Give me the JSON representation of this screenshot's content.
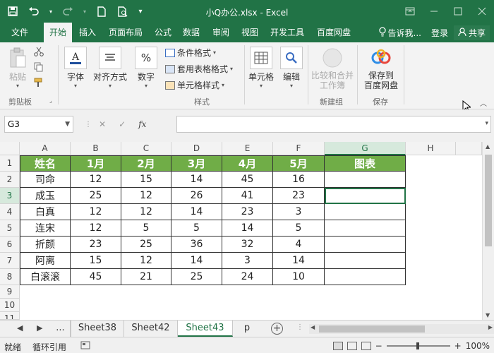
{
  "window": {
    "title": "小Q办公.xlsx - Excel"
  },
  "tabs": [
    {
      "label": "文件"
    },
    {
      "label": "开始"
    },
    {
      "label": "插入"
    },
    {
      "label": "页面布局"
    },
    {
      "label": "公式"
    },
    {
      "label": "数据"
    },
    {
      "label": "审阅"
    },
    {
      "label": "视图"
    },
    {
      "label": "开发工具"
    },
    {
      "label": "百度网盘"
    }
  ],
  "tellme": "告诉我...",
  "login": "登录",
  "share": "共享",
  "ribbon": {
    "paste": "粘贴",
    "clipboard": "剪贴板",
    "font": "字体",
    "align": "对齐方式",
    "number": "数字",
    "percent": "%",
    "cond_format": "条件格式",
    "table_format": "套用表格格式",
    "cell_style": "单元格样式",
    "styles": "样式",
    "cells": "单元格",
    "edit": "编辑",
    "compare_merge_1": "比较和合并",
    "compare_merge_2": "工作簿",
    "new_group": "新建组",
    "save_to_1": "保存到",
    "save_to_2": "百度网盘",
    "save": "保存"
  },
  "formula_bar": {
    "name_box": "G3",
    "fx": "fx",
    "value": ""
  },
  "columns": [
    "A",
    "B",
    "C",
    "D",
    "E",
    "F",
    "G",
    "H"
  ],
  "rows": [
    "1",
    "2",
    "3",
    "4",
    "5",
    "6",
    "7",
    "8",
    "9",
    "10",
    "11"
  ],
  "table": {
    "header": [
      "姓名",
      "1月",
      "2月",
      "3月",
      "4月",
      "5月",
      "图表"
    ],
    "rows": [
      [
        "司命",
        "12",
        "15",
        "14",
        "45",
        "16",
        ""
      ],
      [
        "成玉",
        "25",
        "12",
        "26",
        "41",
        "23",
        ""
      ],
      [
        "白真",
        "12",
        "12",
        "14",
        "23",
        "3",
        ""
      ],
      [
        "连宋",
        "12",
        "5",
        "5",
        "14",
        "5",
        ""
      ],
      [
        "折颜",
        "23",
        "25",
        "36",
        "32",
        "4",
        ""
      ],
      [
        "阿离",
        "15",
        "12",
        "14",
        "3",
        "14",
        ""
      ],
      [
        "白滚滚",
        "45",
        "21",
        "25",
        "24",
        "10",
        ""
      ]
    ]
  },
  "sheets": [
    {
      "label": "..."
    },
    {
      "label": "Sheet38"
    },
    {
      "label": "Sheet42"
    },
    {
      "label": "Sheet43"
    },
    {
      "label": "p"
    }
  ],
  "status": {
    "mode": "就绪",
    "circular": "循环引用",
    "zoom": "100%"
  },
  "colors": {
    "accent": "#217346",
    "header_fill": "#70ad47"
  }
}
